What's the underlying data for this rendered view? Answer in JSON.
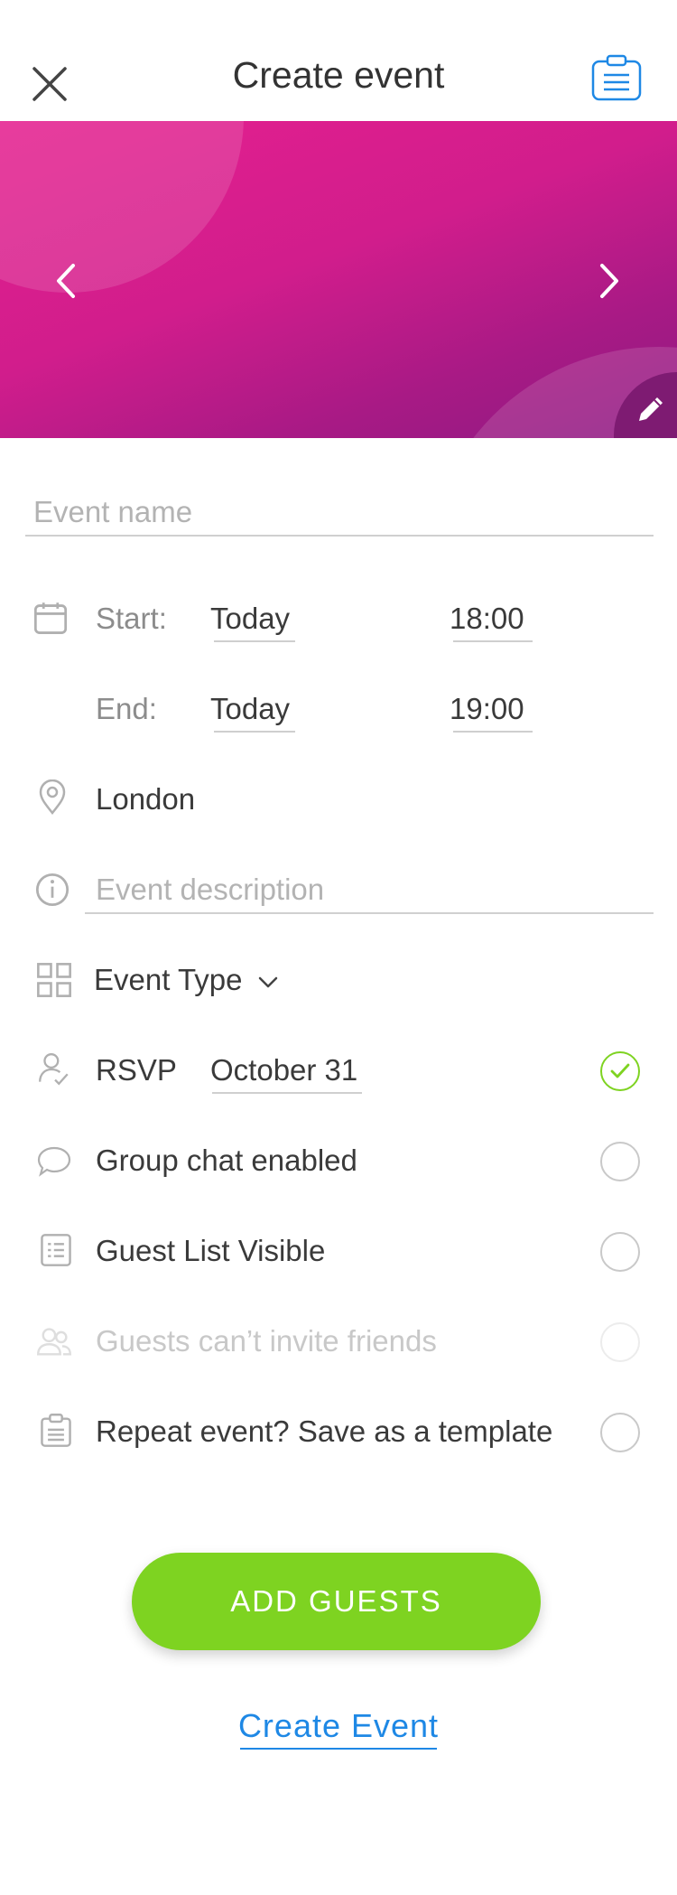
{
  "header": {
    "title": "Create event",
    "close_icon": "close-icon",
    "clipboard_icon": "clipboard-icon",
    "accent_color": "#1e88e5"
  },
  "banner": {
    "gradient_colors": [
      "#e5208f",
      "#8e1a82"
    ],
    "prev_icon": "chevron-left-icon",
    "next_icon": "chevron-right-icon",
    "edit_icon": "pencil-icon"
  },
  "form": {
    "event_name_placeholder": "Event name",
    "start": {
      "label": "Start:",
      "date": "Today",
      "time": "18:00"
    },
    "end": {
      "label": "End:",
      "date": "Today",
      "time": "19:00"
    },
    "location": "London",
    "description_placeholder": "Event description",
    "event_type_label": "Event Type",
    "rsvp": {
      "label": "RSVP",
      "date": "October 31",
      "checked": true
    },
    "options": [
      {
        "label": "Group chat enabled",
        "icon": "chat-bubble-icon",
        "checked": false,
        "disabled": false
      },
      {
        "label": "Guest List Visible",
        "icon": "list-icon",
        "checked": false,
        "disabled": false
      },
      {
        "label": "Guests can’t invite friends",
        "icon": "people-icon",
        "checked": false,
        "disabled": true
      },
      {
        "label": "Repeat event? Save as a template",
        "icon": "clipboard-icon",
        "checked": false,
        "disabled": false
      }
    ]
  },
  "actions": {
    "add_guests": "ADD GUESTS",
    "create_event": "Create Event",
    "primary_color": "#7ed321"
  }
}
